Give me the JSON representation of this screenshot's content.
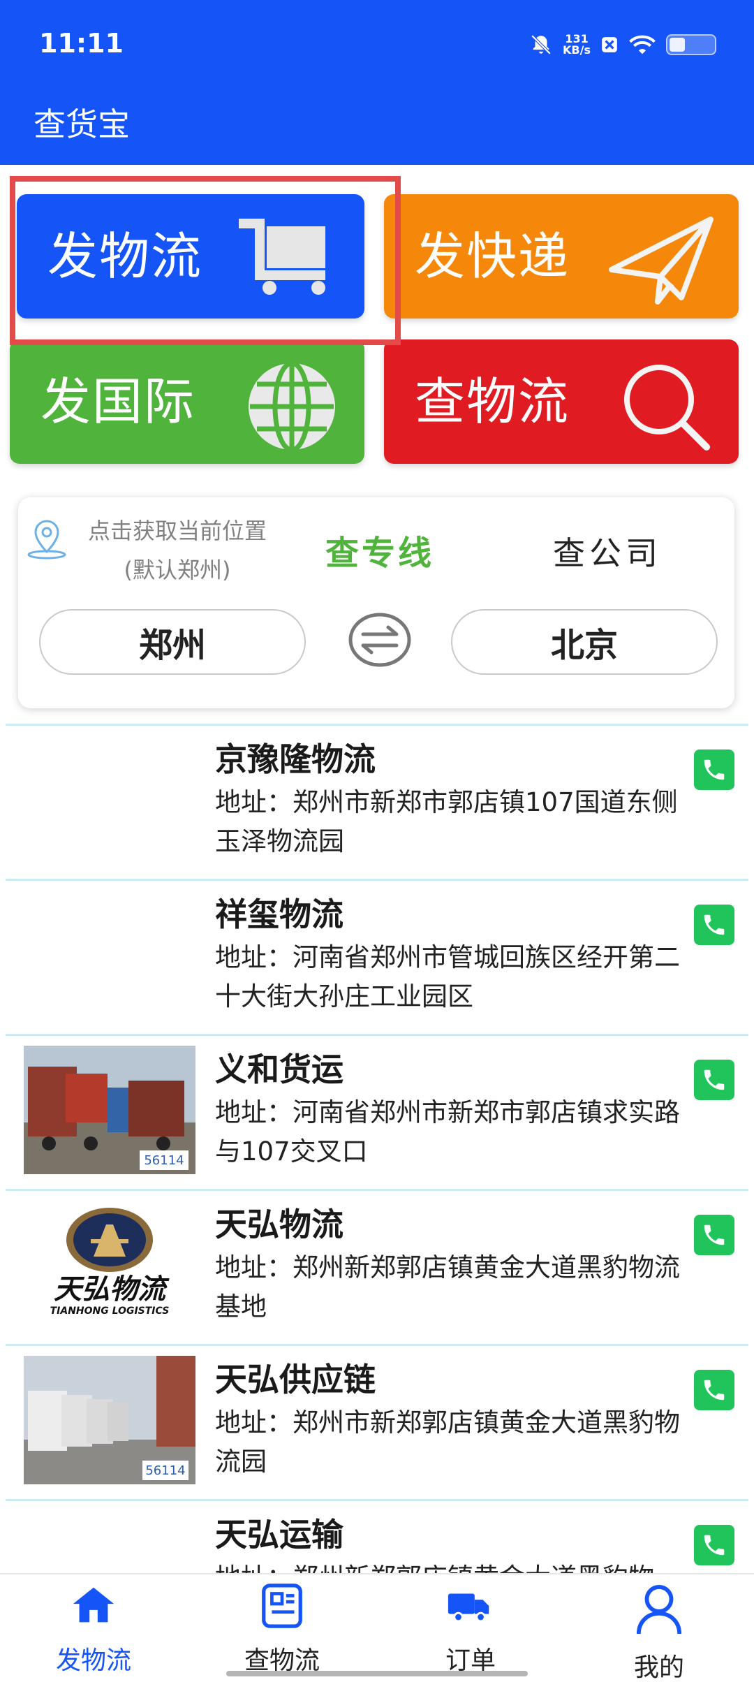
{
  "status_bar": {
    "time": "11:11",
    "net_speed_value": "131",
    "net_speed_unit": "KB/s"
  },
  "app": {
    "title": "查货宝"
  },
  "actions": {
    "send_logistics": "发物流",
    "send_express": "发快递",
    "send_international": "发国际",
    "track_logistics": "查物流"
  },
  "search": {
    "location_line1": "点击获取当前位置",
    "location_line2": "(默认郑州)",
    "tab_lines": "查专线",
    "tab_companies": "查公司",
    "from_city": "郑州",
    "to_city": "北京"
  },
  "list": [
    {
      "name": "京豫隆物流",
      "address": "地址：郑州市新郑市郭店镇107国道东侧玉泽物流园"
    },
    {
      "name": "祥玺物流",
      "address": "地址：河南省郑州市管城回族区经开第二十大街大孙庄工业园区"
    },
    {
      "name": "义和货运",
      "address": "地址：河南省郑州市新郑市郭店镇求实路与107交叉口",
      "thumb_badge": "56114"
    },
    {
      "name": "天弘物流",
      "address": "地址：郑州新郑郭店镇黄金大道黑豹物流基地",
      "logo_text_cn": "天弘物流",
      "logo_text_en": "TIANHONG LOGISTICS"
    },
    {
      "name": "天弘供应链",
      "address": "地址：郑州市新郑郭店镇黄金大道黑豹物流园",
      "thumb_badge": "56114"
    },
    {
      "name": "天弘运输",
      "address": "地址：郑州新郑郭店镇黄金大道黑豹物"
    }
  ],
  "bottom_nav": {
    "items": [
      "发物流",
      "查物流",
      "订单",
      "我的"
    ],
    "active_index": 0
  },
  "colors": {
    "primary": "#1554F6",
    "orange": "#F5880B",
    "green": "#4FB33C",
    "red": "#E01B22",
    "highlight": "#E34A4A",
    "phone": "#21C35B"
  }
}
